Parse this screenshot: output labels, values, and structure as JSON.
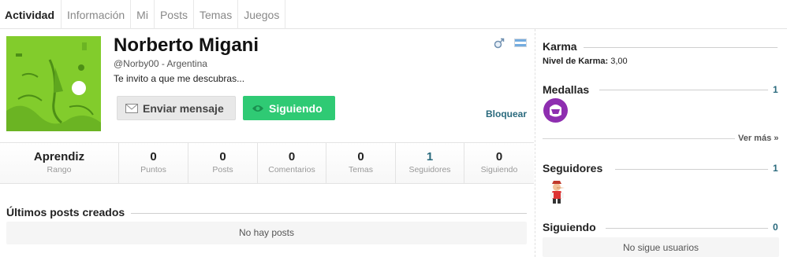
{
  "tabs": [
    "Actividad",
    "Información",
    "Mi",
    "Posts",
    "Temas",
    "Juegos"
  ],
  "profile": {
    "name": "Norberto Migani",
    "handle_line": "@Norby00 - Argentina",
    "bio": "Te invito a que me descubras...",
    "send_message_label": "Enviar mensaje",
    "following_label": "Siguiendo",
    "block_label": "Bloquear",
    "gender_icon": "male-icon",
    "flag_icon": "argentina-flag-icon"
  },
  "stats": [
    {
      "value": "Aprendiz",
      "label": "Rango"
    },
    {
      "value": "0",
      "label": "Puntos"
    },
    {
      "value": "0",
      "label": "Posts"
    },
    {
      "value": "0",
      "label": "Comentarios"
    },
    {
      "value": "0",
      "label": "Temas"
    },
    {
      "value": "1",
      "label": "Seguidores"
    },
    {
      "value": "0",
      "label": "Siguiendo"
    }
  ],
  "posts_section": {
    "title": "Últimos posts creados",
    "empty_text": "No hay posts"
  },
  "sidebar": {
    "karma": {
      "title": "Karma",
      "level_label": "Nivel de Karma:",
      "level_value": "3,00"
    },
    "medals": {
      "title": "Medallas",
      "count": "1",
      "see_more": "Ver más »"
    },
    "followers": {
      "title": "Seguidores",
      "count": "1"
    },
    "following": {
      "title": "Siguiendo",
      "count": "0",
      "empty_text": "No sigue usuarios"
    }
  },
  "colors": {
    "accent_green": "#2fca74",
    "link_blue": "#2a6a7d",
    "medal_purple": "#8e2eb0",
    "avatar_green": "#7fca2b"
  }
}
